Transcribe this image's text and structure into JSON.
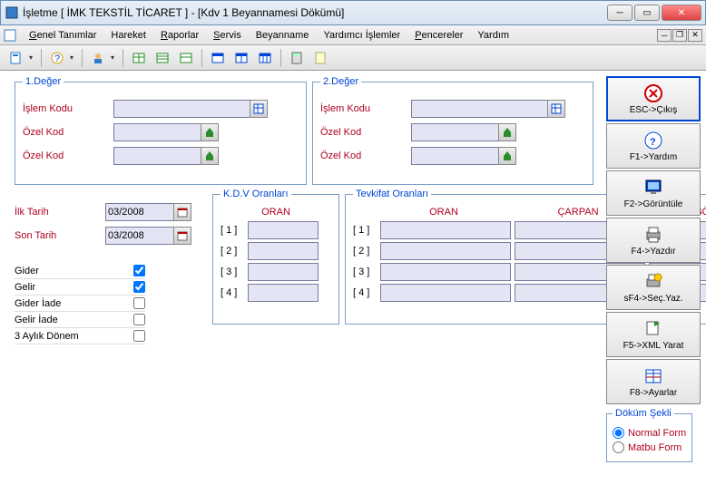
{
  "title": "İşletme [ İMK TEKSTİL TİCARET ]  - [Kdv 1 Beyannamesi Dökümü]",
  "menu": [
    "Genel Tanımlar",
    "Hareket",
    "Raporlar",
    "Servis",
    "Beyanname",
    "Yardımcı İşlemler",
    "Pencereler",
    "Yardım"
  ],
  "grp1": {
    "legend": "1.Değer",
    "rows": [
      {
        "label": "İşlem Kodu",
        "icon": "grid"
      },
      {
        "label": "Özel Kod",
        "icon": "pick"
      },
      {
        "label": "Özel Kod",
        "icon": "pick"
      }
    ]
  },
  "grp2": {
    "legend": "2.Değer",
    "rows": [
      {
        "label": "İşlem Kodu",
        "icon": "grid"
      },
      {
        "label": "Özel Kod",
        "icon": "pick"
      },
      {
        "label": "Özel Kod",
        "icon": "pick"
      }
    ]
  },
  "dates": {
    "ilk": {
      "label": "İlk Tarih",
      "value": "03/2008"
    },
    "son": {
      "label": "Son Tarih",
      "value": "03/2008"
    }
  },
  "checks": [
    {
      "label": "Gider",
      "checked": true
    },
    {
      "label": "Gelir",
      "checked": true
    },
    {
      "label": "Gider İade",
      "checked": false
    },
    {
      "label": "Gelir İade",
      "checked": false
    },
    {
      "label": "3 Aylık Dönem",
      "checked": false
    }
  ],
  "kdv": {
    "legend": "K.D.V Oranları",
    "header": "ORAN",
    "rows": [
      "[ 1 ]",
      "[ 2 ]",
      "[ 3 ]",
      "[ 4 ]"
    ]
  },
  "tev": {
    "legend": "Tevkifat Oranları",
    "headers": [
      "ORAN",
      "ÇARPAN",
      "BÖLEN"
    ],
    "rows": [
      "[ 1 ]",
      "[ 2 ]",
      "[ 3 ]",
      "[ 4 ]"
    ]
  },
  "buttons": [
    {
      "caption": "ESC->Çıkış",
      "icon": "close-red"
    },
    {
      "caption": "F1->Yardım",
      "icon": "help"
    },
    {
      "caption": "F2->Görüntüle",
      "icon": "screen"
    },
    {
      "caption": "F4->Yazdır",
      "icon": "printer"
    },
    {
      "caption": "sF4->Seç.Yaz.",
      "icon": "printer-sel"
    },
    {
      "caption": "F5->XML Yarat",
      "icon": "xml"
    },
    {
      "caption": "F8->Ayarlar",
      "icon": "settings"
    }
  ],
  "dokum": {
    "legend": "Döküm Şekli",
    "options": [
      "Normal Form",
      "Matbu Form"
    ],
    "selected": 0
  }
}
